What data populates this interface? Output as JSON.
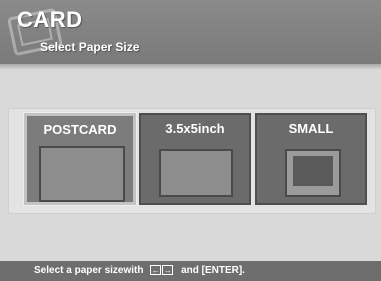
{
  "header": {
    "title": "CARD",
    "subtitle": "Select Paper Size"
  },
  "options": [
    {
      "label": "POSTCARD",
      "selected": true
    },
    {
      "label": "3.5x5inch",
      "selected": false
    },
    {
      "label": "SMALL",
      "selected": false
    }
  ],
  "footer": {
    "text_before": "Select a paper sizewith",
    "left_key": "←",
    "right_key": "→",
    "text_after": "and [ENTER]."
  },
  "icons": {
    "logo": "card-logo-icon",
    "left": "left-arrow-key-icon",
    "right": "right-arrow-key-icon"
  }
}
